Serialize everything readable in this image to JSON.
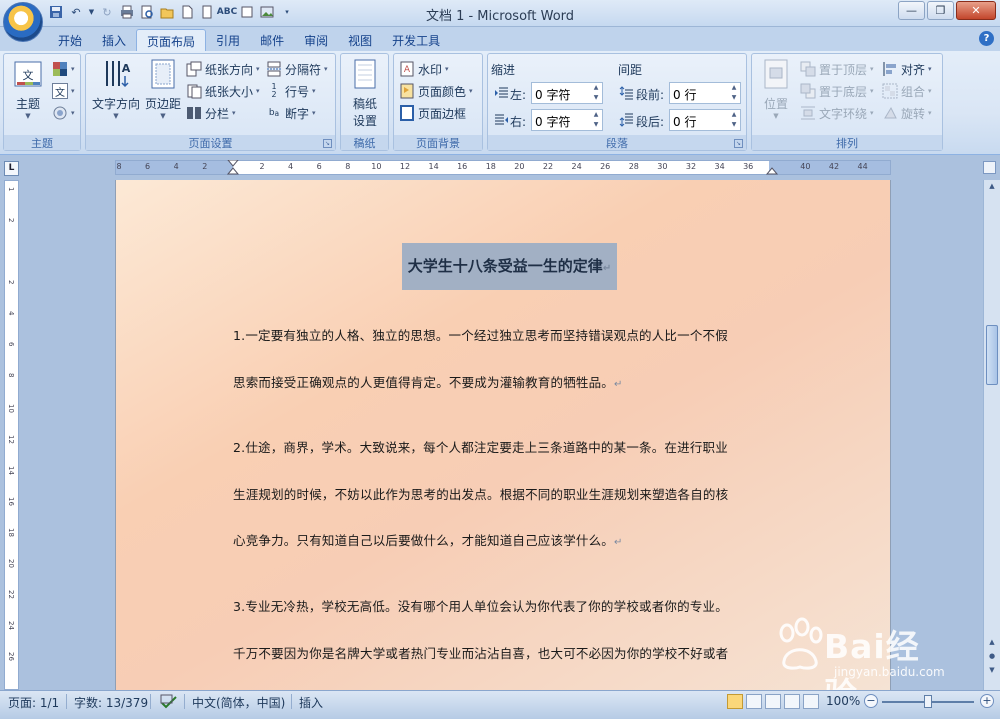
{
  "window": {
    "title": "文档 1 - Microsoft Word",
    "minimize": "—",
    "restore": "❐",
    "close": "✕"
  },
  "tabs": [
    "开始",
    "插入",
    "页面布局",
    "引用",
    "邮件",
    "审阅",
    "视图",
    "开发工具"
  ],
  "active_tab": "页面布局",
  "ribbon": {
    "theme_group": {
      "label": "主题",
      "theme_button": "主题"
    },
    "page_setup": {
      "label": "页面设置",
      "text_direction": "文字方向",
      "margins": "页边距",
      "orientation": "纸张方向",
      "size": "纸张大小",
      "columns": "分栏",
      "breaks": "分隔符",
      "line_numbers": "行号",
      "hyphenation": "断字"
    },
    "manuscript": {
      "label": "稿纸",
      "settings": "稿纸\n设置",
      "settings_line1": "稿纸",
      "settings_line2": "设置"
    },
    "page_background": {
      "label": "页面背景",
      "watermark": "水印",
      "page_color": "页面颜色",
      "page_borders": "页面边框"
    },
    "paragraph": {
      "label": "段落",
      "indent_title": "缩进",
      "spacing_title": "间距",
      "left_label": "左:",
      "left_value": "0 字符",
      "right_label": "右:",
      "right_value": "0 字符",
      "before_label": "段前:",
      "before_value": "0 行",
      "after_label": "段后:",
      "after_value": "0 行"
    },
    "arrange": {
      "label": "排列",
      "position": "位置",
      "bring_front": "置于顶层",
      "send_back": "置于底层",
      "text_wrap": "文字环绕",
      "align": "对齐",
      "group": "组合",
      "rotate": "旋转"
    }
  },
  "ruler": {
    "h_numbers": [
      "8",
      "6",
      "4",
      "2",
      "",
      "2",
      "4",
      "6",
      "8",
      "10",
      "12",
      "14",
      "16",
      "18",
      "20",
      "22",
      "24",
      "26",
      "28",
      "30",
      "32",
      "34",
      "36",
      "",
      "40",
      "42",
      "44"
    ],
    "v_numbers": [
      "1",
      "2",
      "",
      "2",
      "4",
      "6",
      "8",
      "10",
      "12",
      "14",
      "16",
      "18",
      "20",
      "22",
      "24",
      "26"
    ]
  },
  "document": {
    "heading": "大学生十八条受益一生的定律",
    "lines": [
      "1.一定要有独立的人格、独立的思想。一个经过独立思考而坚持错误观点的人比一个不假",
      "思索而接受正确观点的人更值得肯定。不要成为灌输教育的牺牲品。",
      "2.仕途，商界，学术。大致说来，每个人都注定要走上三条道路中的某一条。在进行职业",
      "生涯规划的时候，不妨以此作为思考的出发点。根据不同的职业生涯规划来塑造各自的核",
      "心竞争力。只有知道自己以后要做什么，才能知道自己应该学什么。",
      "3.专业无冷热，学校无高低。没有哪个用人单位会认为你代表了你的学校或者你的专业。",
      "千万不要因为你是名牌大学或者热门专业而沾沾自喜，也大可不必因为你的学校不好或者"
    ],
    "paragraph_mark": "↵"
  },
  "status": {
    "page": "页面: 1/1",
    "words": "字数: 13/379",
    "language": "中文(简体，中国)",
    "mode": "插入",
    "zoom": "100%"
  },
  "watermark": {
    "brand": "Bai经验",
    "url": "jingyan.baidu.com"
  }
}
